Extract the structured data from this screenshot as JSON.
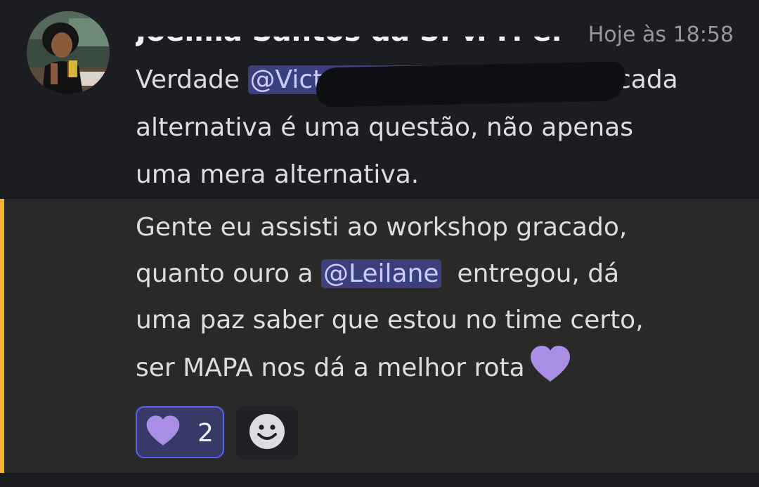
{
  "message": {
    "author": {
      "name": "Joelma Santos da S. v. F. e...",
      "avatar": "person-photo"
    },
    "timestamp": "Hoje às 18:58",
    "first_block": {
      "line1_before": "Verdade ",
      "mention": "@Victoria Tavares Assissset",
      "line1_after": ", cada",
      "line2": "alternativa é uma questão, não apenas",
      "line3": "uma mera alternativa."
    },
    "second_block": {
      "line1": "Gente eu assisti ao workshop gracado,",
      "line2_before": "quanto ouro a ",
      "mention": "@Leilane",
      "line2_after": "  entregou, dá",
      "line3": "uma paz saber que estou no time certo,",
      "line4": "ser MAPA nos dá a melhor rota",
      "emoji": "purple-heart-icon"
    },
    "reactions": [
      {
        "emoji": "purple-heart-icon",
        "count": "2",
        "selected": true
      }
    ],
    "add_reaction_icon": "smile-icon"
  },
  "colors": {
    "background": "#1c1d22",
    "highlight_background": "#2b2927",
    "highlight_bar": "#f0b232",
    "mention_bg": "#3c3f7e",
    "mention_text": "#c9cdfb",
    "heart": "#a98ee6",
    "reaction_border": "#5865f2"
  }
}
